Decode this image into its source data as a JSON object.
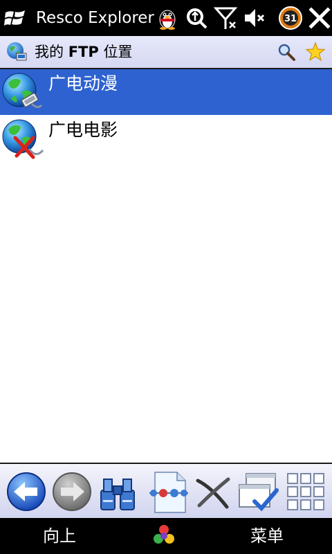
{
  "titlebar": {
    "app_title": "Resco Explorer",
    "icons": [
      "windows-start-icon",
      "qq-penguin-icon",
      "sync-icon",
      "signal-off-icon",
      "volume-mute-icon",
      "clock-badge-icon",
      "close-icon"
    ],
    "clock_badge": "31"
  },
  "location": {
    "title_prefix": "我的",
    "title_bold": "FTP",
    "title_suffix": "位置",
    "icons": [
      "ftp-globe-icon",
      "search-icon",
      "star-icon"
    ]
  },
  "list": {
    "items": [
      {
        "label": "广电动漫",
        "selected": true,
        "icon": "ftp-connected-globe-icon"
      },
      {
        "label": "广电电影",
        "selected": false,
        "icon": "ftp-disconnected-globe-icon"
      }
    ]
  },
  "toolbar": {
    "buttons": [
      "back-arrow-icon",
      "forward-arrow-icon",
      "binoculars-icon",
      "new-connection-icon",
      "cut-icon",
      "window-check-icon",
      "grid-view-icon"
    ]
  },
  "softkeys": {
    "left": "向上",
    "right": "菜单"
  },
  "colors": {
    "selection": "#2e62d0",
    "header_bg": "#d9dcf3",
    "bar_bg": "#000000"
  }
}
